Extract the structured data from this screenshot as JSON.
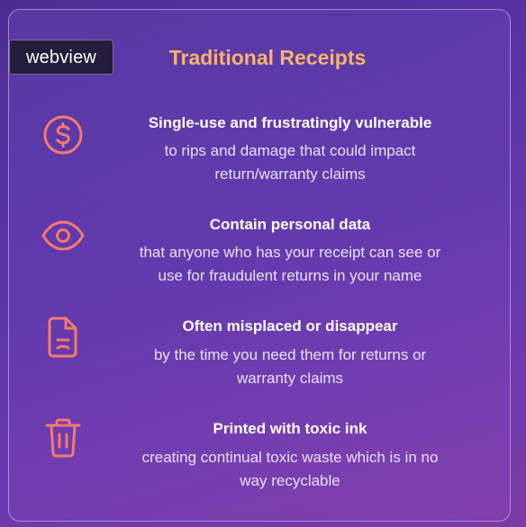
{
  "webview_label": "webview",
  "title": "Traditional Receipts",
  "accent_color": "#f47a6e",
  "title_color": "#f7b36b",
  "items": [
    {
      "icon": "dollar-circle-icon",
      "heading": "Single-use and frustratingly vulnerable",
      "desc_line1": "to rips and damage that could impact",
      "desc_line2": "return/warranty claims"
    },
    {
      "icon": "eye-icon",
      "heading": "Contain personal data",
      "desc_line1": "that anyone who has your receipt can see or",
      "desc_line2": "use for fraudulent returns in your name"
    },
    {
      "icon": "sad-document-icon",
      "heading": "Often misplaced or disappear",
      "desc_line1": "by the time you need them for returns or",
      "desc_line2": "warranty claims"
    },
    {
      "icon": "trash-icon",
      "heading": "Printed with toxic ink",
      "desc_line1": "creating continual toxic waste which is in no",
      "desc_line2": "way recyclable"
    }
  ]
}
